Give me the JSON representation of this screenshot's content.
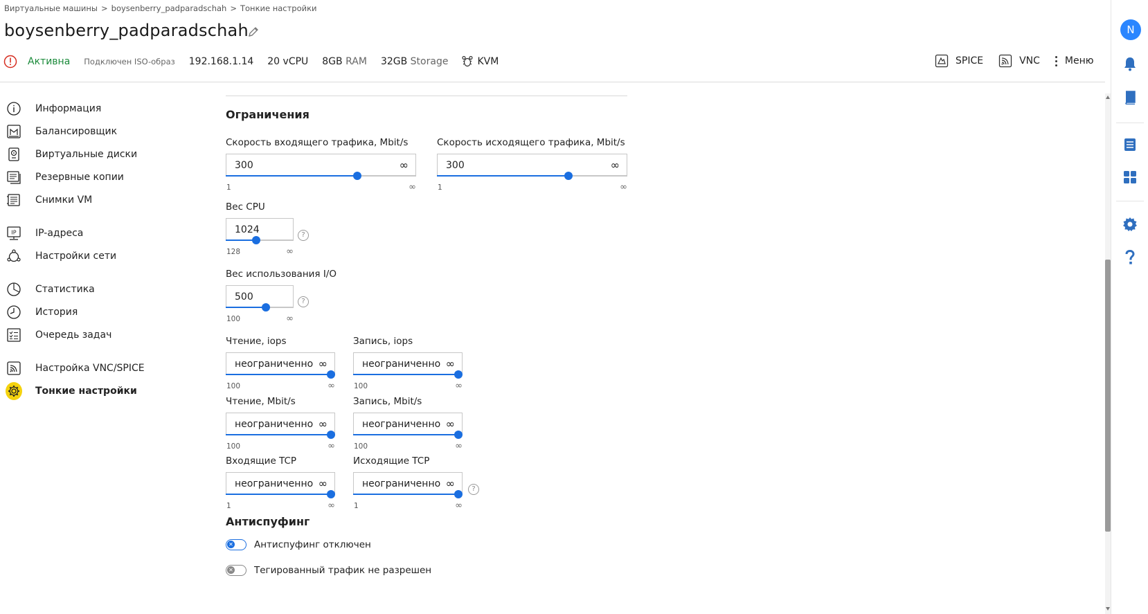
{
  "breadcrumb": {
    "items": [
      "Виртуальные машины",
      "boysenberry_padparadschah",
      "Тонкие настройки"
    ],
    "separator": ">"
  },
  "vm": {
    "name": "boysenberry_padparadschah",
    "status": "Активна",
    "iso": "Подключен ISO-образ",
    "ip": "192.168.1.14",
    "cpu": "20 vCPU",
    "ram_value": "8GB",
    "ram_unit": "RAM",
    "storage_value": "32GB",
    "storage_unit": "Storage",
    "hypervisor": "KVM"
  },
  "actions": {
    "spice": "SPICE",
    "vnc": "VNC",
    "menu": "Меню"
  },
  "sidebar": {
    "items": [
      {
        "label": "Информация",
        "icon": "info-icon"
      },
      {
        "label": "Балансировщик",
        "icon": "balancer-icon"
      },
      {
        "label": "Виртуальные диски",
        "icon": "disk-icon"
      },
      {
        "label": "Резервные копии",
        "icon": "backup-icon"
      },
      {
        "label": "Снимки VM",
        "icon": "snapshot-icon"
      },
      {
        "label": "IP-адреса",
        "icon": "ip-icon"
      },
      {
        "label": "Настройки сети",
        "icon": "network-icon"
      },
      {
        "label": "Статистика",
        "icon": "chart-icon"
      },
      {
        "label": "История",
        "icon": "history-icon"
      },
      {
        "label": "Очередь задач",
        "icon": "tasks-icon"
      },
      {
        "label": "Настройка VNC/SPICE",
        "icon": "vnc-icon"
      },
      {
        "label": "Тонкие настройки",
        "icon": "gear-icon",
        "selected": true
      }
    ]
  },
  "limits": {
    "title": "Ограничения",
    "infinity": "∞",
    "incoming": {
      "label": "Скорость входящего трафика, Mbit/s",
      "value": "300",
      "min": "1",
      "level": 0.7
    },
    "outgoing": {
      "label": "Скорость исходящего трафика, Mbit/s",
      "value": "300",
      "min": "1",
      "level": 0.7
    },
    "cpu_weight": {
      "label": "Вес CPU",
      "value": "1024",
      "min": "128",
      "level": 0.44
    },
    "io_weight": {
      "label": "Вес использования I/O",
      "value": "500",
      "min": "100",
      "level": 0.6
    },
    "read_iops": {
      "label": "Чтение, iops",
      "value": "неограниченно",
      "min": "100",
      "level": 1.0
    },
    "write_iops": {
      "label": "Запись, iops",
      "value": "неограниченно",
      "min": "100",
      "level": 1.0
    },
    "read_mbit": {
      "label": "Чтение, Mbit/s",
      "value": "неограниченно",
      "min": "100",
      "level": 1.0
    },
    "write_mbit": {
      "label": "Запись, Mbit/s",
      "value": "неограниченно",
      "min": "100",
      "level": 1.0
    },
    "in_tcp": {
      "label": "Входящие TCP",
      "value": "неограниченно",
      "min": "1",
      "level": 1.0
    },
    "out_tcp": {
      "label": "Исходящие TCP",
      "value": "неограниченно",
      "min": "1",
      "level": 1.0
    },
    "help": "?"
  },
  "antispoofing": {
    "title": "Антиспуфинг",
    "toggle1": {
      "label": "Антиспуфинг отключен",
      "state": "off"
    },
    "toggle2": {
      "label": "Тегированный трафик не разрешен",
      "state": "off"
    }
  },
  "rail": {
    "avatar_letter": "N"
  },
  "colors": {
    "accent": "#1a6ee0",
    "active_status": "#1a8a3a",
    "warning": "#d62d20",
    "selected_bg": "#f4d20e",
    "avatar": "#2b86ff",
    "rail_icon": "#2f6fbf"
  }
}
